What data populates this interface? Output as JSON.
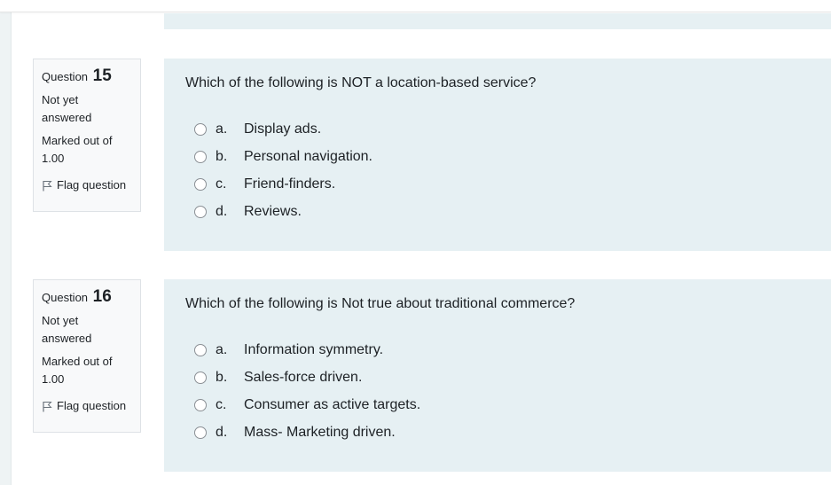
{
  "questions": [
    {
      "label": "Question",
      "number": "15",
      "state": "Not yet answered",
      "grade": "Marked out of 1.00",
      "flag": "Flag question",
      "text": "Which of the following is NOT a location-based service?",
      "answers": [
        {
          "letter": "a.",
          "text": "Display ads."
        },
        {
          "letter": "b.",
          "text": "Personal navigation."
        },
        {
          "letter": "c.",
          "text": "Friend-finders."
        },
        {
          "letter": "d.",
          "text": "Reviews."
        }
      ]
    },
    {
      "label": "Question",
      "number": "16",
      "state": "Not yet answered",
      "grade": "Marked out of 1.00",
      "flag": "Flag question",
      "text": "Which of the following is Not true about traditional commerce?",
      "answers": [
        {
          "letter": "a.",
          "text": "Information symmetry."
        },
        {
          "letter": "b.",
          "text": "Sales-force driven."
        },
        {
          "letter": "c.",
          "text": "Consumer as active targets."
        },
        {
          "letter": "d.",
          "text": "Mass- Marketing driven."
        }
      ]
    }
  ]
}
